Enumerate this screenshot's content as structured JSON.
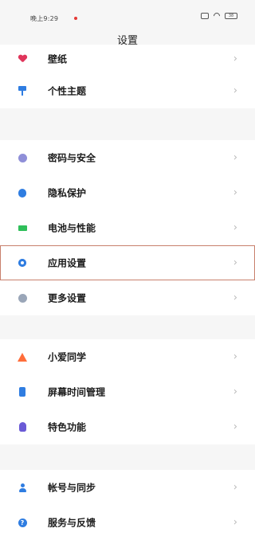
{
  "status_bar": {
    "time": "晚上9:29",
    "battery": "38"
  },
  "header": {
    "title": "设置"
  },
  "groups": [
    {
      "items": [
        {
          "label": "壁纸",
          "icon": "wallpaper-icon",
          "color": "#e0355b"
        },
        {
          "label": "个性主题",
          "icon": "theme-brush-icon",
          "color": "#2f7de1"
        }
      ]
    },
    {
      "items": [
        {
          "label": "密码与安全",
          "icon": "password-security-icon",
          "color": "#8f8fd8"
        },
        {
          "label": "隐私保护",
          "icon": "privacy-shield-icon",
          "color": "#2f7de1"
        },
        {
          "label": "电池与性能",
          "icon": "battery-icon",
          "color": "#2fbf5a"
        },
        {
          "label": "应用设置",
          "icon": "app-settings-gear-icon",
          "color": "#2f7de1"
        },
        {
          "label": "更多设置",
          "icon": "more-settings-icon",
          "color": "#9aa6b8"
        }
      ]
    },
    {
      "items": [
        {
          "label": "小爱同学",
          "icon": "xiaoai-assistant-icon",
          "color": "#ff6d3a"
        },
        {
          "label": "屏幕时间管理",
          "icon": "screen-time-icon",
          "color": "#2f7de1"
        },
        {
          "label": "特色功能",
          "icon": "special-features-icon",
          "color": "#6a5ad6"
        }
      ]
    },
    {
      "items": [
        {
          "label": "帐号与同步",
          "icon": "account-sync-icon",
          "color": "#2f7de1"
        },
        {
          "label": "服务与反馈",
          "icon": "service-feedback-icon",
          "color": "#2f7de1"
        }
      ]
    }
  ],
  "chevron": "›"
}
